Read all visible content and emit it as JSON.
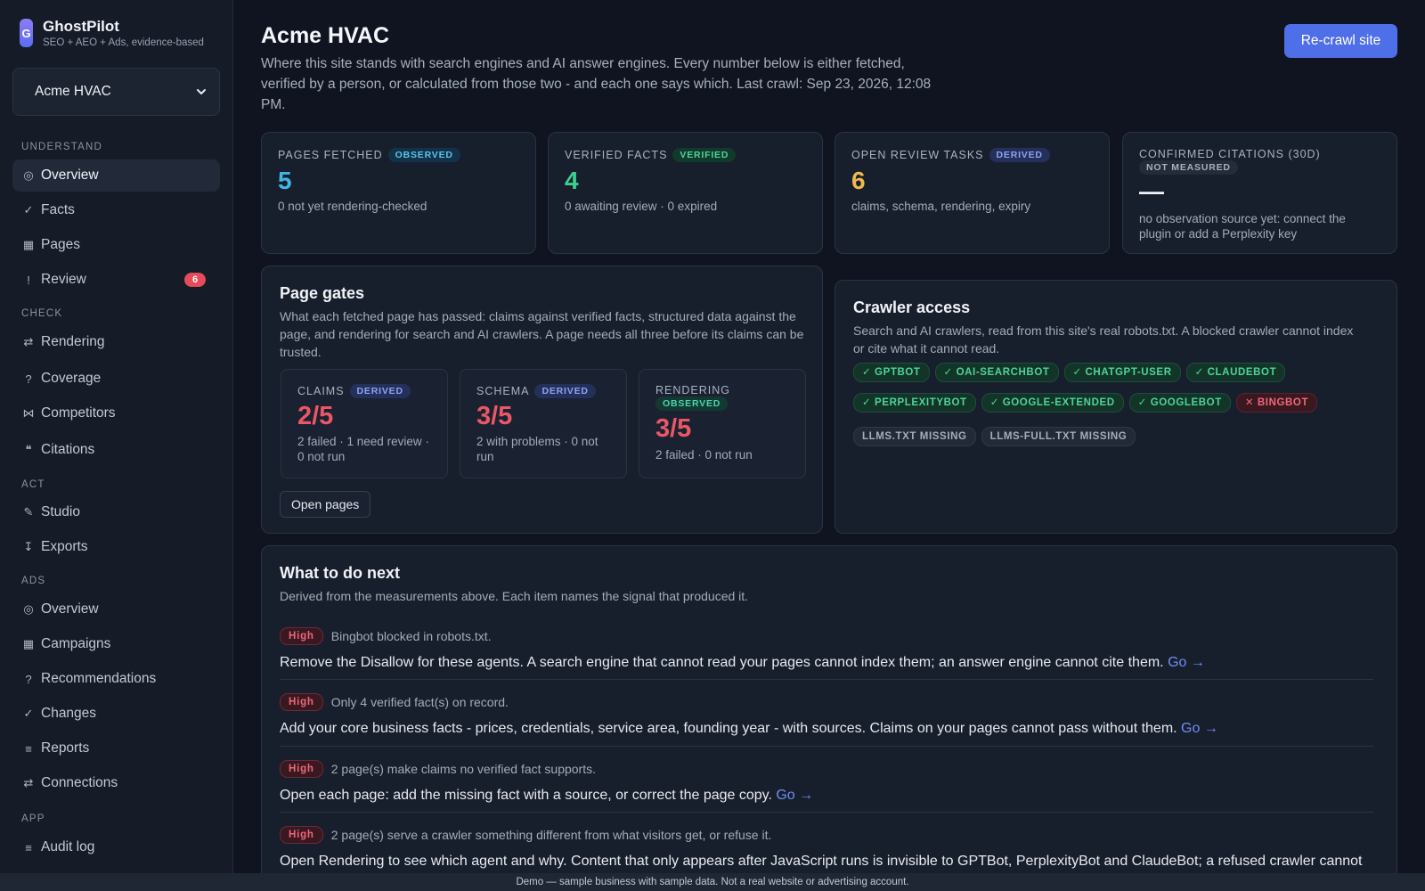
{
  "brand": {
    "logo_letter": "G",
    "name": "GhostPilot",
    "tagline": "SEO + AEO + Ads, evidence-based"
  },
  "site_select": {
    "value": "Acme HVAC"
  },
  "nav": {
    "sections": [
      "Understand",
      "Check",
      "Act",
      "Ads",
      "App"
    ],
    "items": [
      {
        "label": "Overview",
        "glyph": "◎",
        "icon": "target-icon",
        "active": true
      },
      {
        "label": "Facts",
        "glyph": "✓",
        "icon": "check-icon"
      },
      {
        "label": "Pages",
        "glyph": "▦",
        "icon": "page-icon"
      },
      {
        "label": "Review",
        "glyph": "!",
        "icon": "alert-icon",
        "badge": "6"
      },
      {
        "label": "Rendering",
        "glyph": "⇄",
        "icon": "swap-icon"
      },
      {
        "label": "Coverage",
        "glyph": "?",
        "icon": "question-icon"
      },
      {
        "label": "Competitors",
        "glyph": "⋈",
        "icon": "compare-icon"
      },
      {
        "label": "Citations",
        "glyph": "❝",
        "icon": "quote-icon"
      },
      {
        "label": "Studio",
        "glyph": "✎",
        "icon": "pencil-icon"
      },
      {
        "label": "Exports",
        "glyph": "↧",
        "icon": "download-icon"
      },
      {
        "label": "Overview",
        "glyph": "◎",
        "icon": "target-icon"
      },
      {
        "label": "Campaigns",
        "glyph": "▦",
        "icon": "grid-icon"
      },
      {
        "label": "Recommendations",
        "glyph": "?",
        "icon": "question-icon"
      },
      {
        "label": "Changes",
        "glyph": "✓",
        "icon": "check-icon"
      },
      {
        "label": "Reports",
        "glyph": "≡",
        "icon": "list-icon"
      },
      {
        "label": "Connections",
        "glyph": "⇄",
        "icon": "swap-icon"
      },
      {
        "label": "Audit log",
        "glyph": "≡",
        "icon": "list-icon"
      }
    ]
  },
  "header": {
    "title": "Acme HVAC",
    "subtitle": "Where this site stands with search engines and AI answer engines. Every number below is either fetched, verified by a person, or calculated from those two - and each one says which. Last crawl: Sep 23, 2026, 12:08 PM.",
    "recrawl_label": "Re-crawl site"
  },
  "stats": [
    {
      "label": "Pages fetched",
      "tag": "Observed",
      "value": "5",
      "note": "0 not yet rendering-checked",
      "color": "#3fb6e6"
    },
    {
      "label": "Verified facts",
      "tag": "Verified",
      "value": "4",
      "note": "0 awaiting review · 0 expired",
      "color": "#3ecf8e"
    },
    {
      "label": "Open review tasks",
      "tag": "Derived",
      "value": "6",
      "note": "claims, schema, rendering, expiry",
      "color": "#f2b84b"
    },
    {
      "label": "Confirmed citations (30d)",
      "tag": "Not measured",
      "value": "—",
      "note": "no observation source yet: connect the plugin or add a Perplexity key",
      "color": "#f1f3f8"
    }
  ],
  "gates": {
    "title": "Page gates",
    "subtitle": "What each fetched page has passed: claims against verified facts, structured data against the page, and rendering for search and AI crawlers. A page needs all three before its claims can be trusted.",
    "items": [
      {
        "label": "Claims",
        "tag": "Derived",
        "value": "2/5",
        "note": "2 failed · 1 need review · 0 not run"
      },
      {
        "label": "Schema",
        "tag": "Derived",
        "value": "3/5",
        "note": "2 with problems · 0 not run"
      },
      {
        "label": "Rendering",
        "tag": "Observed",
        "value": "3/5",
        "note": "2 failed · 0 not run"
      }
    ],
    "button_label": "Open pages"
  },
  "crawler": {
    "title": "Crawler access",
    "subtitle": "Search and AI crawlers, read from this site's real robots.txt. A blocked crawler cannot index or cite what it cannot read.",
    "allowed": [
      "GPTBot",
      "OAI-SearchBot",
      "ChatGPT-User",
      "ClaudeBot",
      "PerplexityBot",
      "Google-Extended",
      "Googlebot"
    ],
    "blocked": [
      "Bingbot"
    ],
    "missing": [
      "llms.txt missing",
      "llms-full.txt missing"
    ]
  },
  "todo": {
    "title": "What to do next",
    "subtitle": "Derived from the measurements above. Each item names the signal that produced it.",
    "go_label": "Go →",
    "items": [
      {
        "priority": "High",
        "signal": "Bingbot blocked in robots.txt.",
        "action": "Remove the Disallow for these agents. A search engine that cannot read your pages cannot index them; an answer engine cannot cite them."
      },
      {
        "priority": "High",
        "signal": "Only 4 verified fact(s) on record.",
        "action": "Add your core business facts - prices, credentials, service area, founding year - with sources. Claims on your pages cannot pass without them."
      },
      {
        "priority": "High",
        "signal": "2 page(s) make claims no verified fact supports.",
        "action": "Open each page: add the missing fact with a source, or correct the page copy."
      },
      {
        "priority": "High",
        "signal": "2 page(s) serve a crawler something different from what visitors get, or refuse it.",
        "action": "Open Rendering to see which agent and why. Content that only appears after JavaScript runs is invisible to GPTBot, PerplexityBot and ClaudeBot; a refused crawler cannot read the page at all."
      }
    ]
  },
  "footer": {
    "text": "Demo — sample business with sample data. Not a real website or advertising account."
  }
}
